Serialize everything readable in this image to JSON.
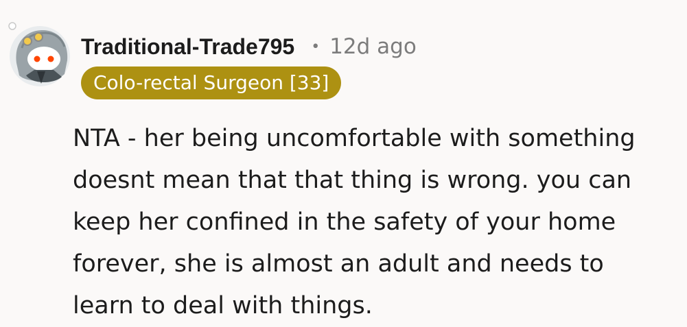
{
  "comment": {
    "avatar": {
      "icon": "snoo-avatar-icon"
    },
    "author": "Traditional-Trade795",
    "separator": "•",
    "timestamp": "12d ago",
    "flair": {
      "text": "Colo-rectal Surgeon [33]",
      "background": "#ad9112",
      "color": "#ffffff"
    },
    "body_lines": [
      "NTA - her being uncomfortable with something",
      "doesnt mean that that thing is wrong. you can",
      "keep her confined in the safety of your home",
      "forever, she is almost an adult and needs to",
      "learn to deal with things."
    ]
  }
}
